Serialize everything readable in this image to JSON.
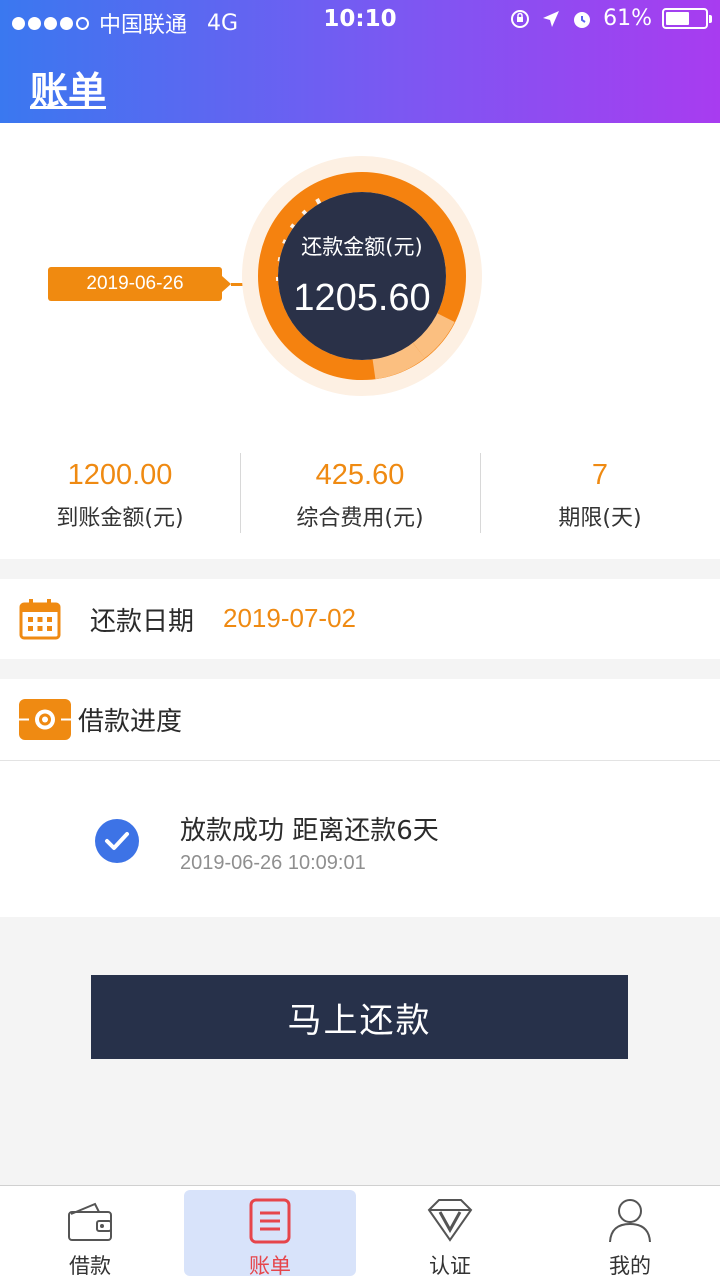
{
  "status_bar": {
    "carrier": "中国联通",
    "network": "4G",
    "time": "10:10",
    "battery": "61%",
    "battery_level": 0.61
  },
  "header": {
    "title": "账单"
  },
  "summary": {
    "ring_title": "还款金额(元)",
    "ring_amount": "1205.60",
    "date_tag": "2019-06-26",
    "stats": [
      {
        "value": "1200.00",
        "label": "到账金额(元)"
      },
      {
        "value": "425.60",
        "label": "综合费用(元)"
      },
      {
        "value": "7",
        "label": "期限(天)"
      }
    ]
  },
  "repayment": {
    "label": "还款日期",
    "date": "2019-07-02"
  },
  "progress": {
    "title": "借款进度",
    "status": "放款成功 距离还款6天",
    "time": "2019-06-26 10:09:01"
  },
  "action": {
    "pay_now": "马上还款"
  },
  "tabbar": {
    "items": [
      {
        "label": "借款",
        "icon": "wallet-icon"
      },
      {
        "label": "账单",
        "icon": "bill-icon"
      },
      {
        "label": "认证",
        "icon": "certify-icon"
      },
      {
        "label": "我的",
        "icon": "profile-icon"
      }
    ],
    "active_index": 1
  },
  "colors": {
    "accent_orange": "#ef8a12",
    "dark_navy": "#27314a",
    "active_tab_bg": "#d8e3fa",
    "active_tab_text": "#e6454b"
  }
}
